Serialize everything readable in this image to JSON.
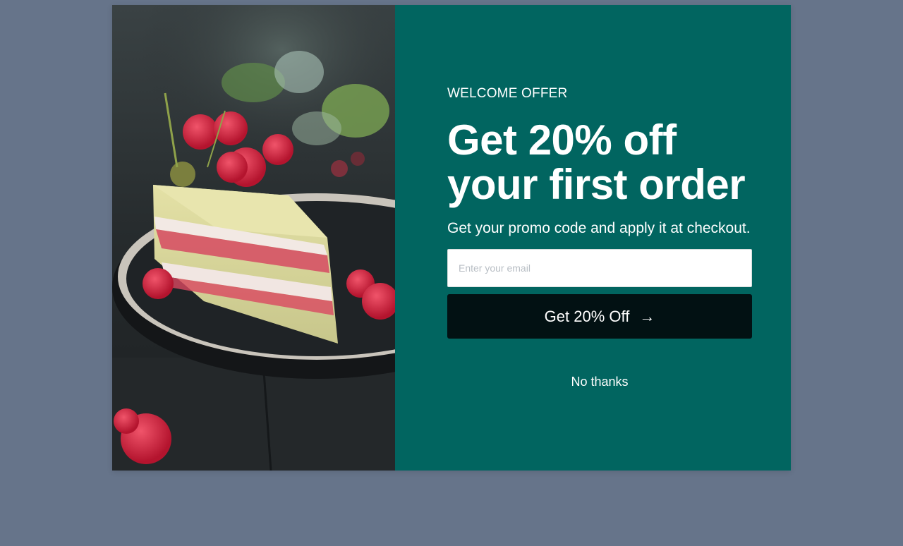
{
  "popup": {
    "image": {
      "alt": "",
      "icon": "cake-photo"
    },
    "eyebrow": "WELCOME OFFER",
    "headline": "Get 20% off your first order",
    "subline": "Get your promo code and apply it at checkout.",
    "email_placeholder": "Enter your email",
    "email_value": "",
    "cta_label": "Get 20% Off",
    "cta_icon": "arrow-right-icon",
    "decline_label": "No thanks"
  },
  "colors": {
    "background": "#66748a",
    "panel": "#016560",
    "button": "#021113",
    "text": "#ffffff"
  }
}
